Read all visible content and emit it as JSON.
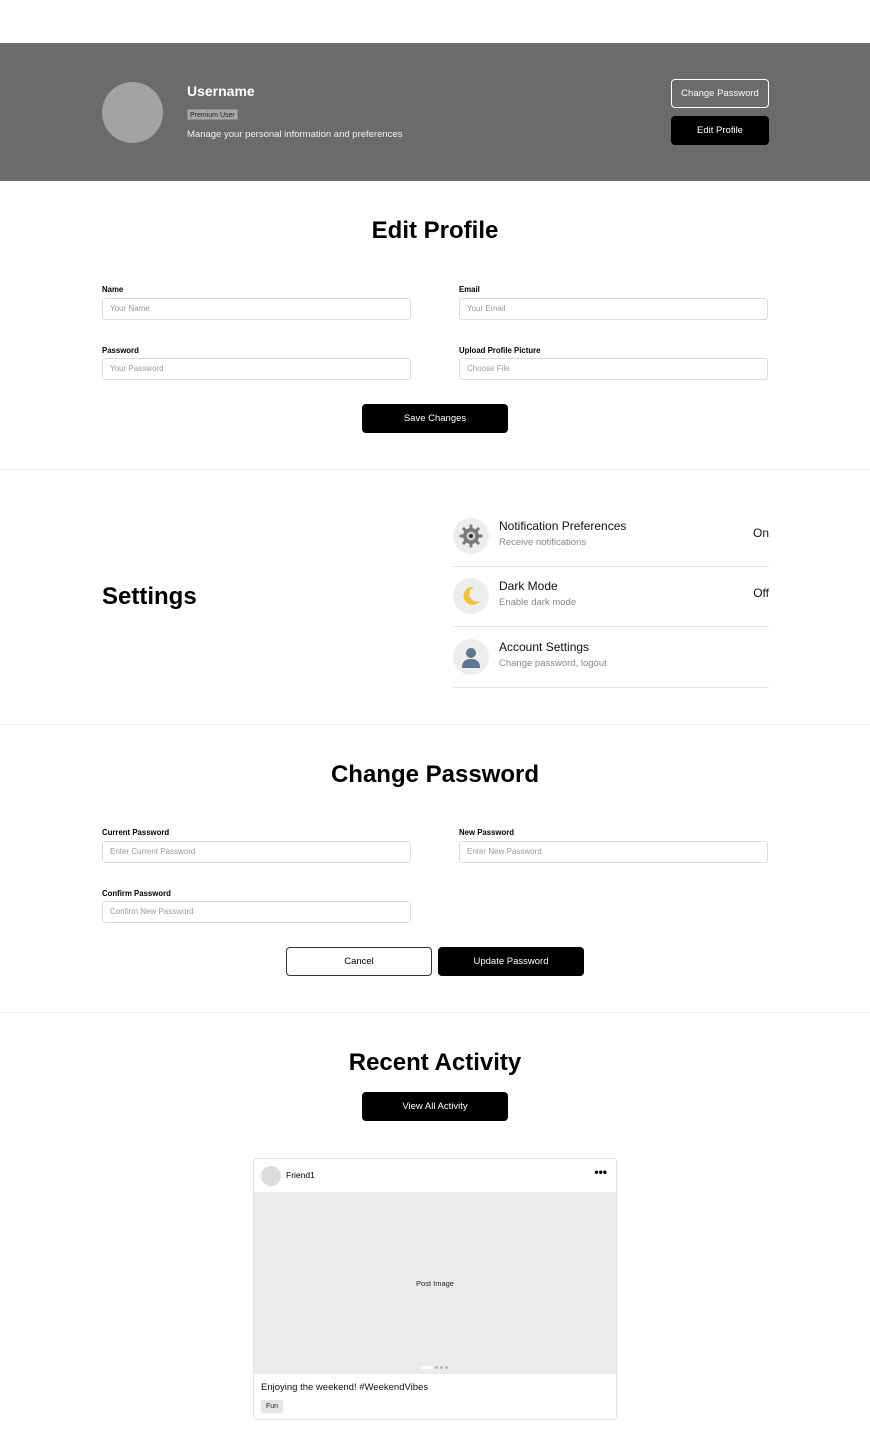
{
  "profile_header": {
    "username": "Username",
    "badge": "Premium User",
    "description": "Manage your personal information and preferences",
    "change_password_label": "Change Password",
    "edit_profile_label": "Edit Profile"
  },
  "edit_profile": {
    "title": "Edit Profile",
    "fields": [
      {
        "label": "Name",
        "placeholder": "Your Name"
      },
      {
        "label": "Email",
        "placeholder": "Your Email"
      },
      {
        "label": "Password",
        "placeholder": "Your Password"
      },
      {
        "label": "Upload Profile Picture",
        "placeholder": "Choose File"
      }
    ],
    "save_label": "Save Changes"
  },
  "settings": {
    "title": "Settings",
    "items": [
      {
        "name": "Notification Preferences",
        "description": "Receive notifications",
        "value": "On",
        "icon": "gear-icon"
      },
      {
        "name": "Dark Mode",
        "description": "Enable dark mode",
        "value": "Off",
        "icon": "moon-icon"
      },
      {
        "name": "Account Settings",
        "description": "Change password, logout",
        "value": "",
        "icon": "user-icon"
      }
    ]
  },
  "change_password": {
    "title": "Change Password",
    "fields": [
      {
        "label": "Current Password",
        "placeholder": "Enter Current Password"
      },
      {
        "label": "New Password",
        "placeholder": "Enter New Password"
      },
      {
        "label": "Confirm Password",
        "placeholder": "Confirm New Password"
      }
    ],
    "cancel_label": "Cancel",
    "update_label": "Update Password"
  },
  "recent_activity": {
    "title": "Recent Activity",
    "view_all_label": "View All Activity",
    "post": {
      "user": "Friend1",
      "more": "•••",
      "image_label": "Post Image",
      "caption": "Enjoying the weekend! #WeekendVibes",
      "tag": "Fun"
    }
  }
}
